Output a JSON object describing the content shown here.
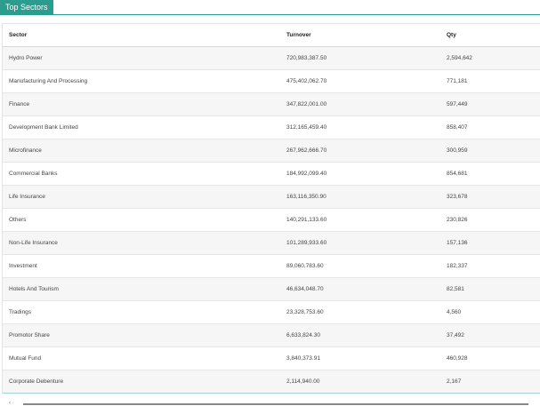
{
  "panel": {
    "tab_label": "Top Sectors"
  },
  "table": {
    "headers": [
      "Sector",
      "Turnover",
      "Qty"
    ],
    "rows": [
      [
        "Hydro Power",
        "720,983,387.50",
        "2,594,642"
      ],
      [
        "Manufacturing And Processing",
        "475,402,062.70",
        "771,181"
      ],
      [
        "Finance",
        "347,822,001.00",
        "597,449"
      ],
      [
        "Development Bank Limited",
        "312,165,459.40",
        "858,407"
      ],
      [
        "Microfinance",
        "267,962,666.70",
        "300,959"
      ],
      [
        "Commercial Banks",
        "184,992,099.40",
        "854,681"
      ],
      [
        "Life Insurance",
        "163,116,350.90",
        "323,678"
      ],
      [
        "Others",
        "140,291,133.60",
        "230,826"
      ],
      [
        "Non-Life Insurance",
        "101,289,933.60",
        "157,136"
      ],
      [
        "Investment",
        "89,060,783.60",
        "182,337"
      ],
      [
        "Hotels And Tourism",
        "46,634,048.70",
        "82,581"
      ],
      [
        "Tradings",
        "23,328,753.60",
        "4,560"
      ],
      [
        "Promotor Share",
        "6,633,824.30",
        "37,492"
      ],
      [
        "Mutual Fund",
        "3,840,373.91",
        "460,928"
      ],
      [
        "Corporate Debenture",
        "2,114,940.00",
        "2,167"
      ]
    ]
  },
  "colors": {
    "accent": "#2a9d8f"
  }
}
